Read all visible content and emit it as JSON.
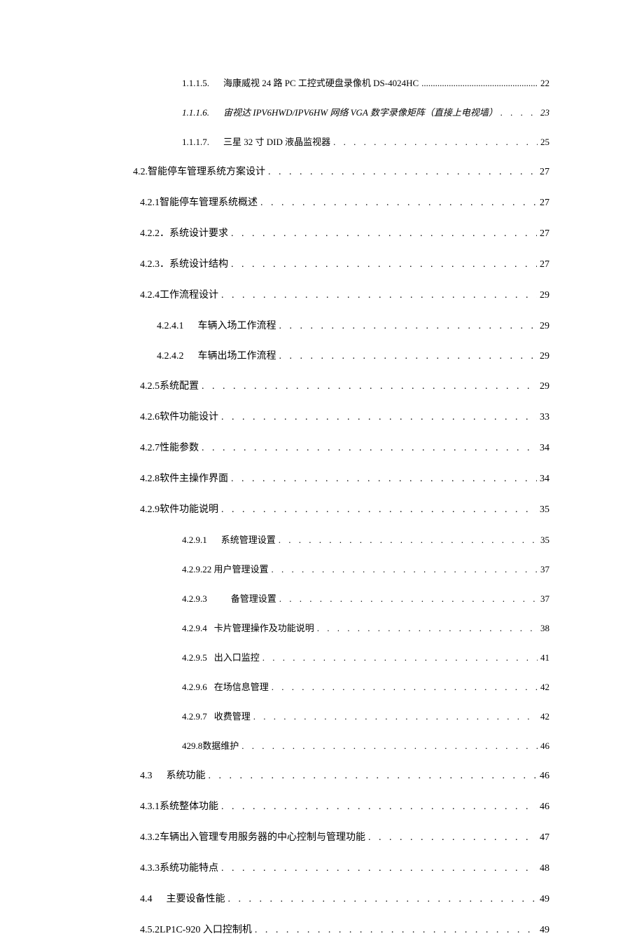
{
  "toc": [
    {
      "num": "1.1.1.5.",
      "text": "海康威视 24 路 PC 工控式硬盘录像机 DS-4024HC",
      "page": "22",
      "level": 4,
      "numGap": "wide",
      "dense": true
    },
    {
      "num": "1.1.1.6.",
      "text": "宙视达 IPV6HWD/IPV6HW 网络 VGA 数字录像矩阵（直接上电视墙）",
      "page": "23",
      "level": 4,
      "numGap": "wide",
      "italic": true
    },
    {
      "num": "1.1.1.7.",
      "text": "三星 32 寸 DID 液晶监视器",
      "page": "25",
      "level": 4,
      "numGap": "wide"
    },
    {
      "num": "4.2.",
      "text": "智能停车管理系统方案设计",
      "page": "27",
      "level": 1
    },
    {
      "num": "4.2.1",
      "text": " 智能停车管理系统概述",
      "page": "27",
      "level": 2
    },
    {
      "num": "4.2.2",
      "text": "．系统设计要求",
      "page": "27",
      "level": 2
    },
    {
      "num": "4.2.3",
      "text": "．系统设计结构",
      "page": "27",
      "level": 2
    },
    {
      "num": "4.2.4",
      "text": " 工作流程设计",
      "page": "29",
      "level": 2
    },
    {
      "num": "4.2.4.1",
      "text": "车辆入场工作流程",
      "page": "29",
      "level": 3,
      "numGap": "wide"
    },
    {
      "num": "4.2.4.2",
      "text": "车辆出场工作流程",
      "page": "29",
      "level": 3,
      "numGap": "wide"
    },
    {
      "num": "4.2.5",
      "text": " 系统配置",
      "page": "29",
      "level": 2
    },
    {
      "num": "4.2.6",
      "text": " 软件功能设计",
      "page": "33",
      "level": 2
    },
    {
      "num": "4.2.7",
      "text": " 性能参数",
      "page": "34",
      "level": 2
    },
    {
      "num": "4.2.8",
      "text": " 软件主操作界面",
      "page": "34",
      "level": 2
    },
    {
      "num": "4.2.9",
      "text": " 软件功能说明",
      "page": "35",
      "level": 2
    },
    {
      "num": "4.2.9.1",
      "text": "系统管理设置",
      "page": "35",
      "level": 4,
      "numGap": "wide"
    },
    {
      "num": "4.2.9.2",
      "text": " 2 用户管理设置",
      "page": "37",
      "level": 4
    },
    {
      "num": "4.2.9.3",
      "text": "备管理设置",
      "page": "37",
      "level": 4,
      "numGap": "wide",
      "extraGap": true
    },
    {
      "num": "4.2.9.4",
      "text": "卡片管理操作及功能说明",
      "page": "38",
      "level": 4,
      "numGap": "small"
    },
    {
      "num": "4.2.9.5",
      "text": "出入口监控",
      "page": "41",
      "level": 4,
      "numGap": "small"
    },
    {
      "num": "4.2.9.6",
      "text": "在场信息管理",
      "page": "42",
      "level": 4,
      "numGap": "small"
    },
    {
      "num": "4.2.9.7",
      "text": "收费管理",
      "page": "42",
      "level": 4,
      "numGap": "small"
    },
    {
      "num": "429.8",
      "text": " 数据维护",
      "page": "46",
      "level": 4
    },
    {
      "num": "4.3",
      "text": "系统功能",
      "page": "46",
      "level": 2,
      "numGap": "wide"
    },
    {
      "num": "4.3.1",
      "text": " 系统整体功能",
      "page": "46",
      "level": 2
    },
    {
      "num": "4.3.2",
      "text": " 车辆出入管理专用服务器的中心控制与管理功能",
      "page": "47",
      "level": 2
    },
    {
      "num": "4.3.3",
      "text": " 系统功能特点",
      "page": "48",
      "level": 2
    },
    {
      "num": "4.4",
      "text": "主要设备性能",
      "page": "49",
      "level": 2,
      "numGap": "wide"
    },
    {
      "num": "4.5.2",
      "text": " LP1C-920 入口控制机",
      "page": "49",
      "level": 2
    }
  ]
}
